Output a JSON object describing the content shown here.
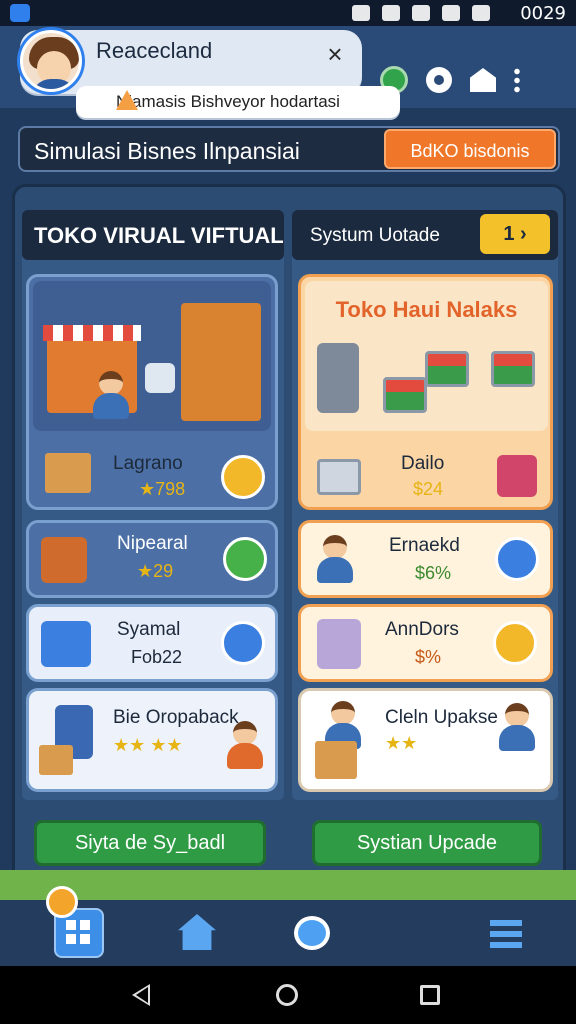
{
  "status_bar": {
    "time": "0029"
  },
  "app": {
    "title": "Reacecland",
    "close": "×"
  },
  "notice": {
    "text": "Niamasis Bishveyor hodartasi"
  },
  "banner": {
    "title": "Simulasi Bisnes  Ilnpansiai",
    "button": "BdKO bisdonis"
  },
  "left_column": {
    "header": "TOKO VIRUAL VIFTUAL",
    "cards": [
      {
        "name": "Lagrano",
        "value": "★798"
      },
      {
        "name": "Nipearal",
        "value": "★29"
      },
      {
        "name": "Syamal",
        "value": "Fob22"
      },
      {
        "name": "Bie  Oropaback",
        "value": "★★ ★★"
      }
    ]
  },
  "right_column": {
    "header": "Systum Uotade",
    "next_label": "1 ›",
    "store_sign": "Toko Haui Nalaks",
    "cards": [
      {
        "name": "Dailo",
        "value": "$24"
      },
      {
        "name": "Ernaekd",
        "value": "$6%"
      },
      {
        "name": "AnnDors",
        "value": "$%"
      },
      {
        "name": "Cleln Upakse",
        "value": "★★"
      }
    ]
  },
  "buttons": {
    "left": "Siyta de Sy_badl",
    "right": "Systian Upcade"
  },
  "icons": {
    "bottom_nav": [
      "grid-icon",
      "home-icon",
      "chat-icon",
      "menu-icon"
    ],
    "system_nav": [
      "back-icon",
      "home-circle-icon",
      "recents-icon"
    ]
  },
  "colors": {
    "accent_orange": "#f0772a",
    "action_green": "#2f9b45",
    "panel_blue": "#2d4c73",
    "highlight_yellow": "#f3c22a"
  }
}
